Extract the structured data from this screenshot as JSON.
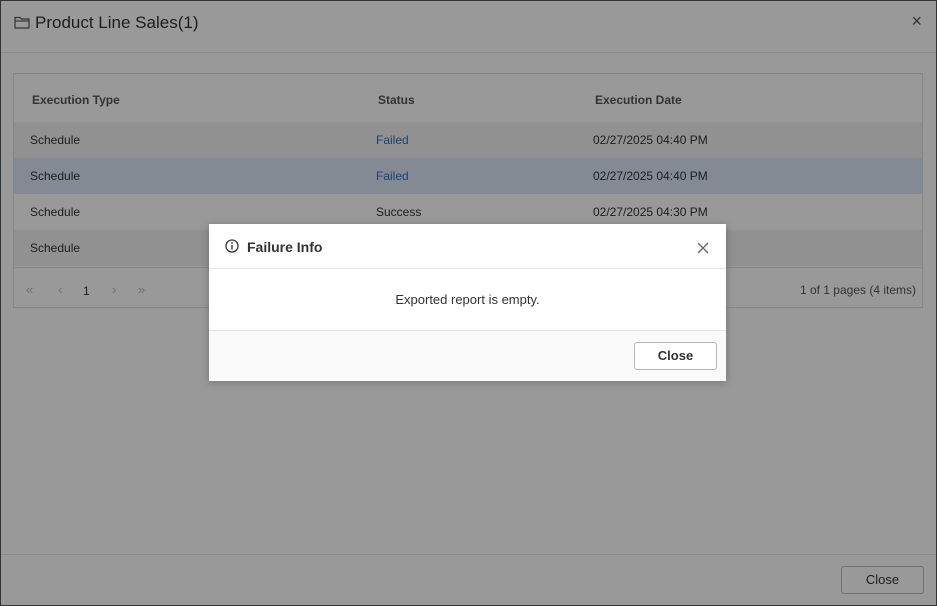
{
  "window": {
    "title": "Product Line Sales(1)",
    "close_glyph": "×",
    "footer_close_label": "Close"
  },
  "grid": {
    "columns": [
      "Execution Type",
      "Status",
      "Execution Date"
    ],
    "rows": [
      {
        "type": "Schedule",
        "status": "Failed",
        "date": "02/27/2025 04:40 PM"
      },
      {
        "type": "Schedule",
        "status": "Failed",
        "date": "02/27/2025 04:40 PM"
      },
      {
        "type": "Schedule",
        "status": "Success",
        "date": "02/27/2025 04:30 PM"
      },
      {
        "type": "Schedule",
        "status": "",
        "date": ""
      }
    ],
    "pager": {
      "first": "«",
      "prev": "‹",
      "page": "1",
      "next": "›",
      "last": "»",
      "info": "1 of 1 pages (4 items)"
    }
  },
  "dialog": {
    "title": "Failure Info",
    "message": "Exported report is empty.",
    "close_label": "Close"
  },
  "colors": {
    "link": "#2f6fc6",
    "selected_row": "#dce6f5",
    "overlay": "rgba(0,0,0,0.40)"
  }
}
